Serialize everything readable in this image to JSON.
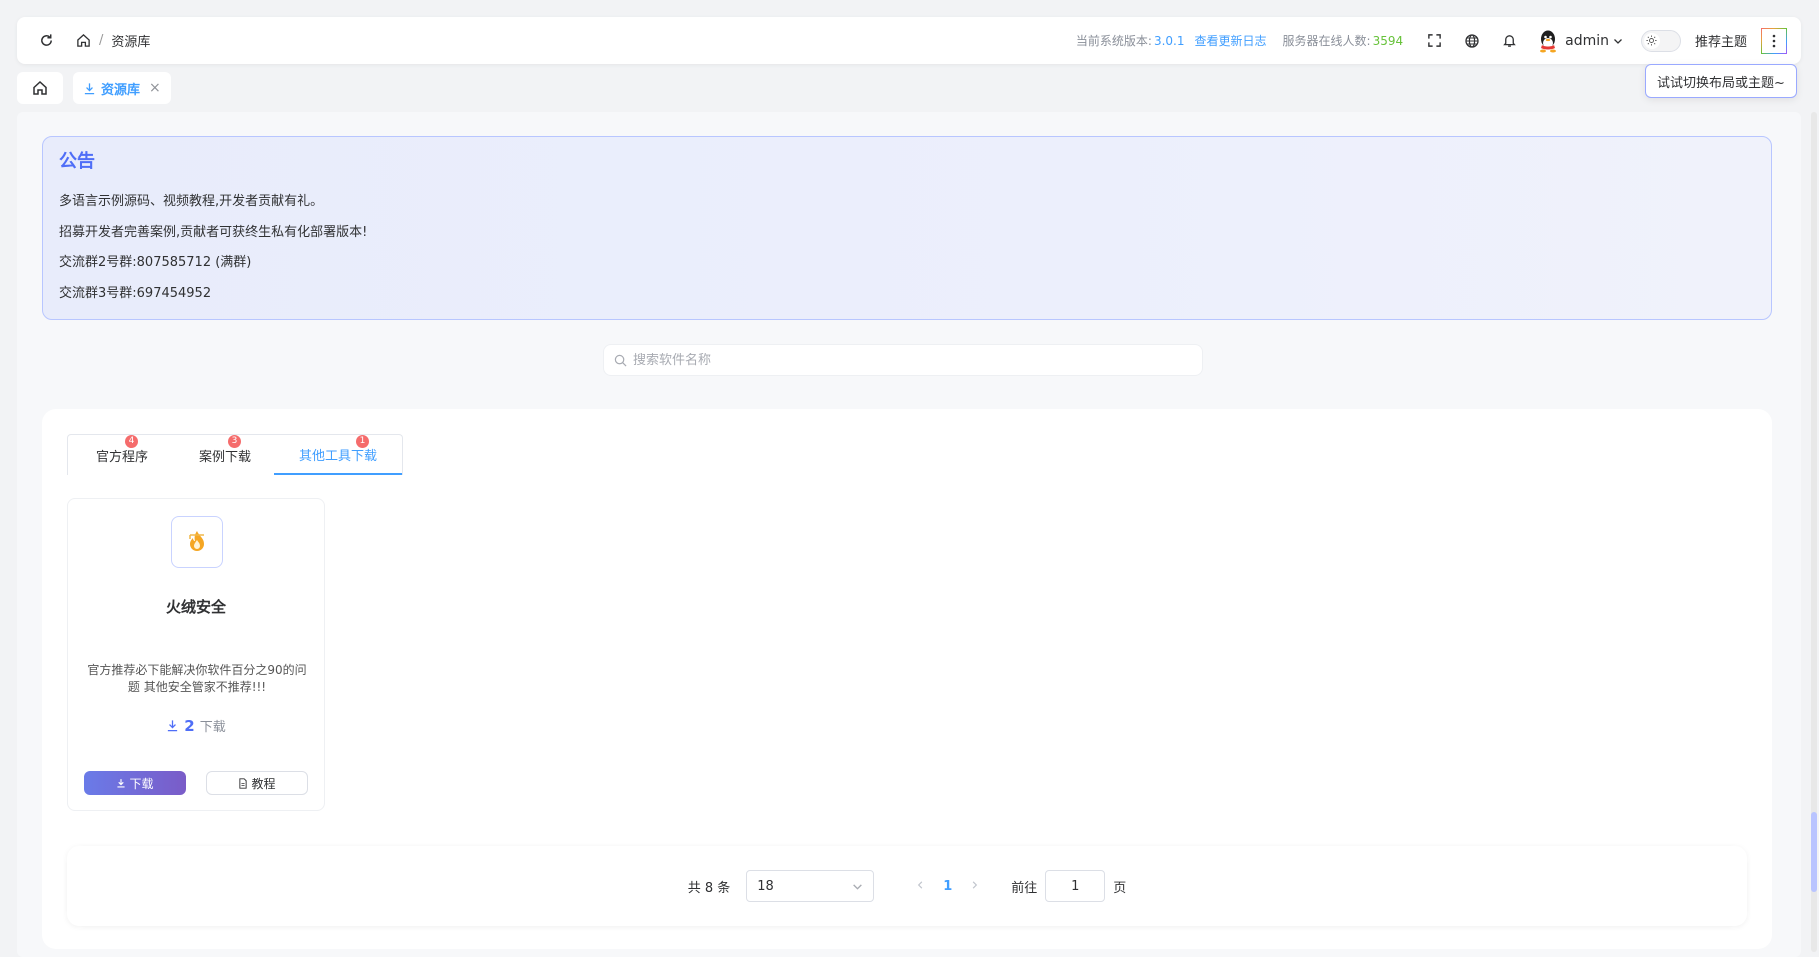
{
  "header": {
    "breadcrumb_current": "资源库",
    "version_label": "当前系统版本:",
    "version_value": "3.0.1",
    "changelog_link": "查看更新日志",
    "online_label": "服务器在线人数:",
    "online_value": "3594",
    "username": "admin",
    "theme_label": "推荐主题"
  },
  "tooltip": "试试切换布局或主题~",
  "tabs": {
    "active_label": "资源库",
    "close_glyph": "×"
  },
  "notice": {
    "title": "公告",
    "lines": [
      "多语言示例源码、视频教程,开发者贡献有礼。",
      "招募开发者完善案例,贡献者可获终生私有化部署版本!",
      "交流群2号群:807585712 (满群)",
      "交流群3号群:697454952"
    ]
  },
  "search": {
    "placeholder": "搜索软件名称"
  },
  "category_tabs": [
    {
      "label": "官方程序",
      "badge": "4"
    },
    {
      "label": "案例下载",
      "badge": "3"
    },
    {
      "label": "其他工具下载",
      "badge": "1"
    }
  ],
  "card": {
    "title": "火绒安全",
    "description": "官方推荐必下能解决你软件百分之90的问题 其他安全管家不推荐!!!",
    "download_count": "2",
    "download_count_suffix": "下载",
    "download_button": "下载",
    "tutorial_button": "教程"
  },
  "pagination": {
    "total_text": "共 8 条",
    "page_size": "18",
    "current_page": "1",
    "goto_label": "前往",
    "goto_value": "1",
    "page_suffix": "页"
  },
  "colors": {
    "accent": "#409eff",
    "notice_title": "#4f6ef7",
    "online_green": "#67c23a",
    "badge_red": "#f56c6c"
  }
}
